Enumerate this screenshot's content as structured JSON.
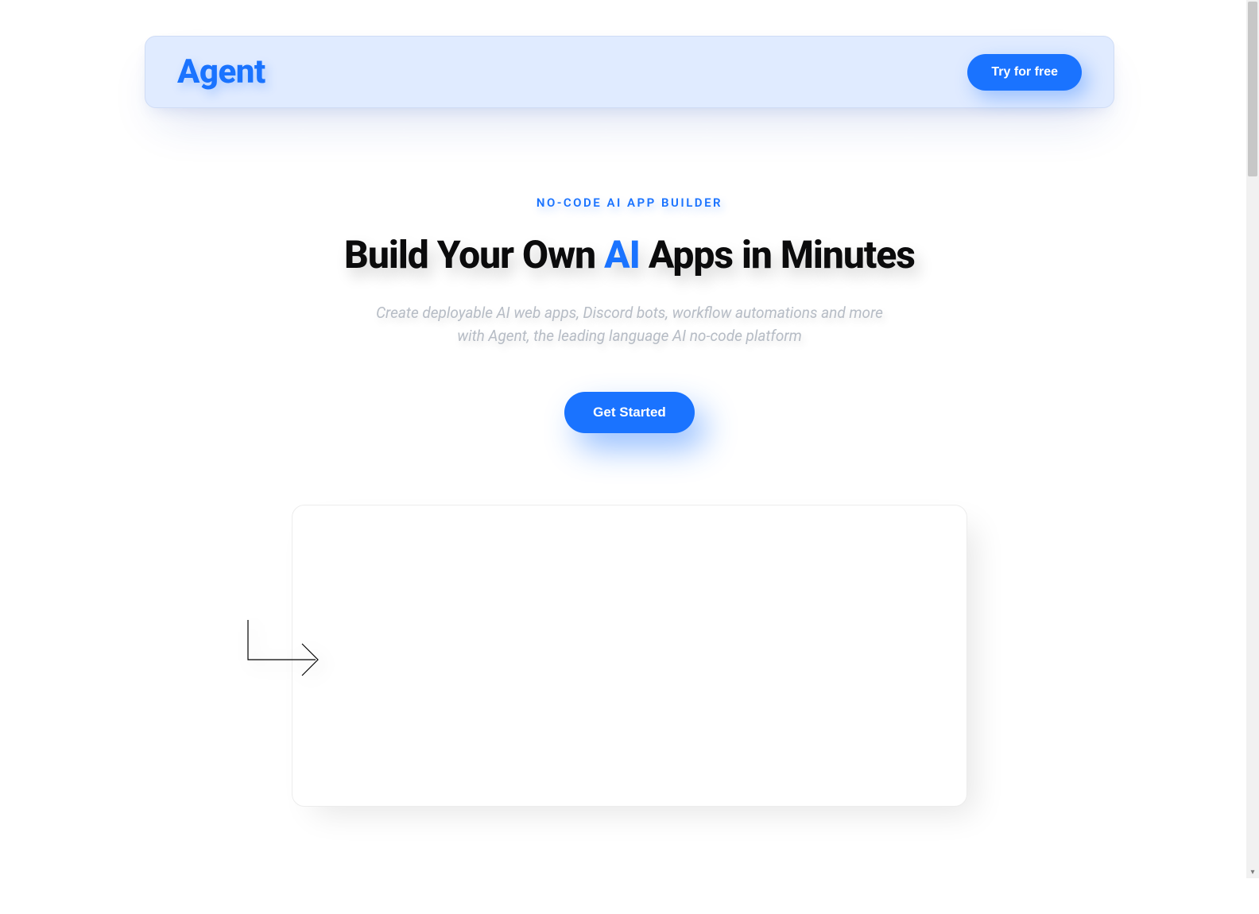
{
  "header": {
    "logo": "Agent",
    "cta_label": "Try for free"
  },
  "hero": {
    "eyebrow": "NO-CODE AI APP BUILDER",
    "title_before": "Build Your Own ",
    "title_accent": "AI",
    "title_after": " Apps in Minutes",
    "subtitle_line1": "Create deployable AI web apps, Discord bots, workflow automations and more",
    "subtitle_line2": "with Agent, the leading language AI no-code platform",
    "cta_label": "Get Started"
  },
  "colors": {
    "accent": "#1a73ff",
    "header_bg": "#e0ebff"
  }
}
